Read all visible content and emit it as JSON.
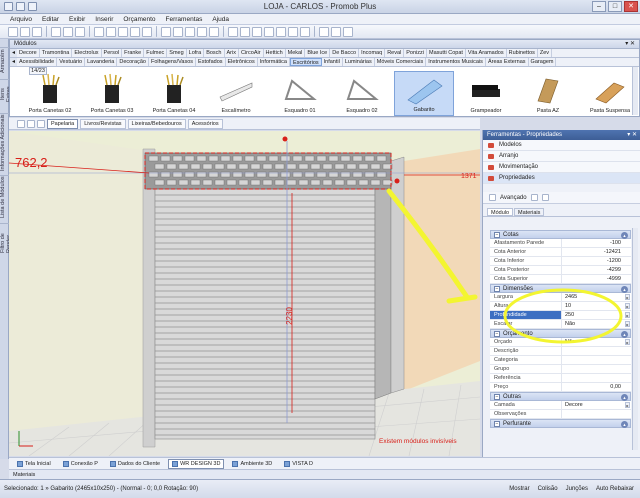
{
  "window": {
    "title": "LOJA - CARLOS - Promob Plus",
    "minimize": "–",
    "maximize": "□",
    "close": "✕"
  },
  "menu": [
    "Arquivo",
    "Editar",
    "Exibir",
    "Inserir",
    "Orçamento",
    "Ferramentas",
    "Ajuda"
  ],
  "modules": {
    "header": "Módulos",
    "pin": "▾ ✕",
    "tabs_row1": [
      "Decore",
      "Tramontina",
      "Electrolux",
      "Persol",
      "Franke",
      "Fulmec",
      "Smeg",
      "Lofra",
      "Bosch",
      "Arix",
      "CircoAir",
      "Hettich",
      "Mekal",
      "Blue Ice",
      "De Bacco",
      "Incomaq",
      "Reval",
      "Ponizzi",
      "Masutti Copat",
      "Vita Aramados",
      "Rubinettos",
      "Zev"
    ],
    "tabs_row2": [
      "Acessibilidade",
      "Vestuário",
      "Lavanderia",
      "Decoração",
      "Folhagens/Vasos",
      "Estofados",
      "Eletrônicos",
      "Informática",
      "Escritórios",
      "Infantil",
      "Luminárias",
      "Móveis Comerciais",
      "Instrumentos Musicais",
      "Áreas Externas",
      "Garagem"
    ],
    "active_tab": "Escritórios",
    "counter": "14/23",
    "items": [
      {
        "label": "Porta Canetas 02",
        "icon": "pen-holder-icon",
        "selected": false
      },
      {
        "label": "Porta Canetas 03",
        "icon": "pen-holder-icon",
        "selected": false
      },
      {
        "label": "Porta Canetas 04",
        "icon": "pen-holder-icon",
        "selected": false
      },
      {
        "label": "Escalímetro",
        "icon": "scale-ruler-icon",
        "selected": false
      },
      {
        "label": "Esquadro 01",
        "icon": "set-square-icon",
        "selected": false
      },
      {
        "label": "Esquadro 02",
        "icon": "set-square-icon",
        "selected": false
      },
      {
        "label": "Gabarito",
        "icon": "template-ruler-icon",
        "selected": true
      },
      {
        "label": "Grampeador",
        "icon": "stapler-icon",
        "selected": false
      },
      {
        "label": "Pasta AZ",
        "icon": "binder-icon",
        "selected": false
      },
      {
        "label": "Pasta Suspensa",
        "icon": "hanging-folder-icon",
        "selected": false
      }
    ]
  },
  "view_tabs": [
    "Papelaria",
    "Livros/Revistas",
    "Lixeiras/Bebedouros",
    "Acessórios"
  ],
  "active_view_tab": "Papelaria",
  "viewport": {
    "dim_left": "762,2",
    "dim_right": "1371",
    "dim_vertical": "2230",
    "hidden_note": "Existem módulos invisíveis"
  },
  "left_vertical_tabs": [
    "Armazém",
    "Itens Extras",
    "Informações Adicionais",
    "Lista de Módulos",
    "Filtro de Render"
  ],
  "props": {
    "header": "Ferramentas - Propriedades",
    "nav": [
      "Modelos",
      "Arranjo",
      "Movimentação",
      "Propriedades"
    ],
    "active_nav": "Propriedades",
    "advanced": "Avançado",
    "subtabs": [
      "Módulo",
      "Materiais"
    ],
    "sections": [
      {
        "title": "Cotas",
        "rows": [
          {
            "k": "Afastamento Parede",
            "v": "-100"
          },
          {
            "k": "Cota Anterior",
            "v": "-12421"
          },
          {
            "k": "Cota Inferior",
            "v": "-1200"
          },
          {
            "k": "Cota Posterior",
            "v": "-4299"
          },
          {
            "k": "Cota Superior",
            "v": "-4999"
          }
        ]
      },
      {
        "title": "Dimensões",
        "rows": [
          {
            "k": "Largura",
            "v": "2465"
          },
          {
            "k": "Altura",
            "v": "10"
          },
          {
            "k": "Profundidade",
            "v": "250"
          },
          {
            "k": "Escalar",
            "v": "Não"
          }
        ]
      },
      {
        "title": "Orçamento",
        "rows": [
          {
            "k": "Orçado",
            "v": "Não"
          },
          {
            "k": "Descrição",
            "v": ""
          },
          {
            "k": "Categoria",
            "v": ""
          },
          {
            "k": "Grupo",
            "v": ""
          },
          {
            "k": "Referência",
            "v": ""
          },
          {
            "k": "Preço",
            "v": "0,00"
          }
        ]
      },
      {
        "title": "Outras",
        "rows": [
          {
            "k": "Camada",
            "v": "Decore"
          },
          {
            "k": "Observações",
            "v": ""
          }
        ]
      },
      {
        "title": "Perfurante",
        "rows": []
      }
    ]
  },
  "bottom_tabs": [
    "Tela Inicial",
    "Conexão P",
    "Dados do Cliente",
    "WR DESIGN 3D",
    "Ambiente 3D",
    "VISTA D"
  ],
  "active_bottom_tab": "WR DESIGN 3D",
  "materials_bar": "Materiais",
  "status": {
    "left": "Selecionado: 1 » Gabarito (2465x10x250) - (Normal - 0; 0,0 Rotação: 90)",
    "right": [
      "Mostrar",
      "Colisão",
      "Junções",
      "Auto Rebaixar"
    ]
  },
  "colors": {
    "accent_blue": "#3d6fc2",
    "highlight_yellow": "#f3f531",
    "dimension_red": "#d8201a"
  }
}
